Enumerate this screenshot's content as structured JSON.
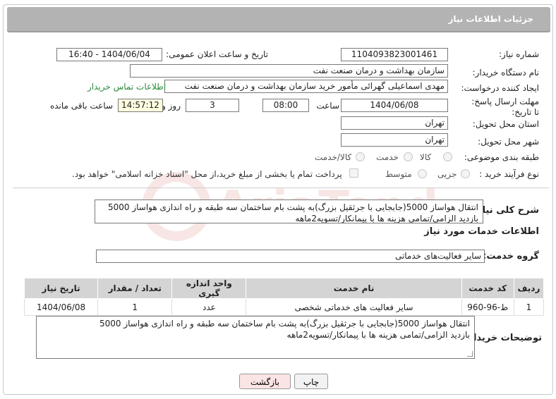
{
  "header": {
    "title": "جزئیات اطلاعات نیاز"
  },
  "fields": {
    "need_number_label": "شماره نیاز:",
    "need_number": "1104093823001461",
    "announce_label": "تاریخ و ساعت اعلان عمومی:",
    "announce_value": "1404/06/04 - 16:40",
    "buyer_org_label": "نام دستگاه خریدار:",
    "buyer_org": "سازمان بهداشت و درمان صنعت نفت",
    "requester_label": "ایجاد کننده درخواست:",
    "requester": "مهدی اسماعیلی گهرائی مأمور خرید سازمان بهداشت و درمان صنعت نفت",
    "contact_link": "اطلاعات تماس خریدار",
    "deadline_label": "مهلت ارسال پاسخ: تا تاریخ:",
    "deadline_date": "1404/06/08",
    "time_label": "ساعت",
    "deadline_time": "08:00",
    "days_value": "3",
    "days_label": "روز و",
    "remaining_time": "14:57:12",
    "remaining_label": "ساعت باقی مانده",
    "province_label": "استان محل تحویل:",
    "province": "تهران",
    "city_label": "شهر محل تحویل:",
    "city": "تهران",
    "category_label": "طبقه بندی موضوعی:",
    "category_options": [
      "کالا",
      "خدمت",
      "کالا/خدمت"
    ],
    "process_label": "نوع فرآیند خرید :",
    "process_options": [
      "جزیی",
      "متوسط"
    ],
    "payment_note": "پرداخت تمام یا بخشی از مبلغ خرید،از محل \"اسناد خزانه اسلامی\" خواهد بود."
  },
  "description": {
    "label": "شرح کلی نیاز:",
    "text_line1": "انتقال هواساز 5000(جابجایی با جرثقیل بزرگ)به پشت بام ساختمان سه طبقه و راه اندازی هواساز 5000",
    "text_line2": "بازدید الزامی/تمامی هزینه ها با پیمانکار/تسویه2ماهه"
  },
  "services": {
    "section_title": "اطلاعات خدمات مورد نیاز",
    "group_label": "گروه خدمت:",
    "group_value": "سایر فعالیت‌های خدماتی",
    "columns": [
      "ردیف",
      "کد خدمت",
      "نام خدمت",
      "واحد اندازه گیری",
      "تعداد / مقدار",
      "تاریخ نیاز"
    ],
    "rows": [
      [
        "1",
        "ط-96-960",
        "سایر فعالیت های خدماتی شخصی",
        "عدد",
        "1",
        "1404/06/08"
      ]
    ]
  },
  "buyer_notes": {
    "label": "توضیحات خریدار:",
    "text_line1": "انتقال هواساز 5000(جابجایی با جرثقیل بزرگ)به پشت بام ساختمان سه طبقه و راه اندازی هواساز 5000",
    "text_line2": "بازدید الزامی/تمامی هزینه ها با پیمانکار/تسویه2ماهه"
  },
  "buttons": {
    "print": "چاپ",
    "back": "بازگشت"
  },
  "colors": {
    "header_bg": "#b3b3b3",
    "link": "#2a8a3a",
    "back_btn_bg": "#fbe4e4"
  },
  "watermark_text": "AriaTender.neT"
}
